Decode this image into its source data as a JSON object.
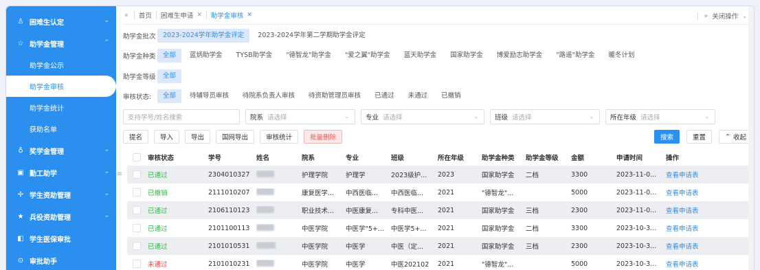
{
  "sidebar": {
    "items": [
      {
        "icon": "user-icon",
        "glyph": "♙",
        "label": "困难生认定",
        "chev": "⌄"
      },
      {
        "icon": "star-icon",
        "glyph": "☆",
        "label": "助学金管理",
        "chev": "⌃",
        "children": [
          "助学金公示",
          "助学金审核",
          "助学金统计",
          "获助名单"
        ]
      },
      {
        "icon": "award-icon",
        "glyph": "♁",
        "label": "奖学金管理",
        "chev": "⌄"
      },
      {
        "icon": "work-icon",
        "glyph": "▣",
        "label": "勤工助学",
        "chev": "⌄"
      },
      {
        "icon": "plus-icon",
        "glyph": "✢",
        "label": "学生资助管理",
        "chev": "⌄"
      },
      {
        "icon": "soldier-star-icon",
        "glyph": "★",
        "label": "兵役资助管理",
        "chev": "⌄"
      },
      {
        "icon": "insurance-icon",
        "glyph": "◧",
        "label": "学生医保审批",
        "chev": ""
      },
      {
        "icon": "assistant-icon",
        "glyph": "⊙",
        "label": "审批助手",
        "chev": ""
      }
    ],
    "active_child": "助学金审核"
  },
  "tabs": {
    "items": [
      "首页",
      "困难生申请",
      "助学金审核"
    ],
    "active": "助学金审核",
    "close_ops": "关闭操作"
  },
  "filters": {
    "batch": {
      "label": "助学金批次",
      "options": [
        "2023-2024学年助学金评定",
        "2023-2024学年第二学期助学金评定"
      ],
      "active": 0
    },
    "kind": {
      "label": "助学金种类",
      "options": [
        "全部",
        "蓝炳助学金",
        "TYSB助学金",
        "\"德智龙\"助学金",
        "\"爱之翼\"助学金",
        "蓝天助学金",
        "国家助学金",
        "博爱励志助学金",
        "\"路遥\"助学金",
        "暖冬计划"
      ],
      "active": 0
    },
    "level": {
      "label": "助学金等级",
      "options": [
        "全部"
      ],
      "active": 0
    },
    "status": {
      "label": "审核状态:",
      "options": [
        "全部",
        "待辅导员审核",
        "待院系负责人审核",
        "待资助管理员审核",
        "已通过",
        "未通过",
        "已撤销"
      ],
      "active": 0
    }
  },
  "search": {
    "keyword_placeholder": "支持学号/姓名搜索",
    "college_label": "院系",
    "college_placeholder": "请选择",
    "major_label": "专业",
    "major_placeholder": "请选择",
    "class_label": "班级",
    "class_placeholder": "请选择",
    "grade_label": "所在年级",
    "grade_placeholder": "请选择"
  },
  "actions": {
    "buttons": [
      "提名",
      "导入",
      "导出",
      "国网导出",
      "审核统计"
    ],
    "batch_delete": "批量删除",
    "search": "搜索",
    "reset": "重置",
    "collapse": "收起"
  },
  "table": {
    "headers": [
      "审核状态",
      "学号",
      "姓名",
      "院系",
      "专业",
      "班级",
      "所在年级",
      "助学金种类",
      "助学金等级",
      "金额",
      "申请时间",
      "操作"
    ],
    "rows": [
      {
        "status": "已通过",
        "status_type": "ok",
        "id": "2304010327",
        "college": "护理学院",
        "major": "护理学",
        "class": "2023级护...",
        "grade": "2023",
        "kind": "国家助学金",
        "level": "二档",
        "amount": "3300",
        "time": "2023-11-0...",
        "op": "查看申请表"
      },
      {
        "status": "已撤销",
        "status_type": "undo",
        "id": "2111010207",
        "college": "康复医学...",
        "major": "中西医临...",
        "class": "中西医临...",
        "grade": "2021",
        "kind": "\"德智龙\"...",
        "level": "",
        "amount": "5000",
        "time": "2023-11-0...",
        "op": "查看申请表"
      },
      {
        "status": "已通过",
        "status_type": "ok",
        "id": "2106110123",
        "college": "职业技术...",
        "major": "中医康复...",
        "class": "专科中医...",
        "grade": "2021",
        "kind": "国家助学金",
        "level": "三档",
        "amount": "2300",
        "time": "2023-11-0...",
        "op": "查看申请表"
      },
      {
        "status": "已通过",
        "status_type": "ok",
        "id": "2101100113",
        "college": "中医学院",
        "major": "中医学\"5+...",
        "class": "中医学5+...",
        "grade": "2021",
        "kind": "国家助学金",
        "level": "二档",
        "amount": "3300",
        "time": "2023-10-3...",
        "op": "查看申请表"
      },
      {
        "status": "已通过",
        "status_type": "ok",
        "id": "2101010531",
        "college": "中医学院",
        "major": "中医学",
        "class": "中医（定...",
        "grade": "2021",
        "kind": "国家助学金",
        "level": "三档",
        "amount": "2300",
        "time": "2023-10-3...",
        "op": "查看申请表"
      },
      {
        "status": "未通过",
        "status_type": "fail",
        "id": "2101010231",
        "college": "中医学院",
        "major": "中医学",
        "class": "中医202102",
        "grade": "2021",
        "kind": "\"德智龙\"...",
        "level": "",
        "amount": "5000",
        "time": "2023-10-3...",
        "op": "查看申请表"
      }
    ]
  },
  "colors": {
    "primary": "#2b8ff0",
    "ok": "#3bb24b",
    "fail": "#e54545",
    "danger_bg": "#fde8e8"
  }
}
